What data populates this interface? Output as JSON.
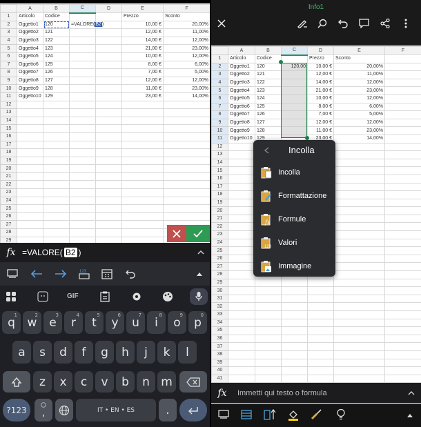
{
  "left": {
    "columns": [
      "A",
      "B",
      "C",
      "D",
      "E",
      "F"
    ],
    "headers": {
      "A": "Articolo",
      "B": "Codice",
      "E": "Prezzo",
      "F": "Sconto"
    },
    "rows": [
      {
        "a": "Oggetto1",
        "b": "120",
        "c": "=VALORE(",
        "e": "10,00 €",
        "f": "20,00%"
      },
      {
        "a": "Oggetto2",
        "b": "121",
        "e": "12,00 €",
        "f": "11,00%"
      },
      {
        "a": "Oggetto3",
        "b": "122",
        "e": "14,00 €",
        "f": "12,00%"
      },
      {
        "a": "Oggetto4",
        "b": "123",
        "e": "21,00 €",
        "f": "23,00%"
      },
      {
        "a": "Oggetto5",
        "b": "124",
        "e": "10,00 €",
        "f": "12,00%"
      },
      {
        "a": "Oggetto6",
        "b": "125",
        "e": "8,00 €",
        "f": "6,00%"
      },
      {
        "a": "Oggetto7",
        "b": "126",
        "e": "7,00 €",
        "f": "5,00%"
      },
      {
        "a": "Oggetto8",
        "b": "127",
        "e": "12,00 €",
        "f": "12,00%"
      },
      {
        "a": "Oggetto9",
        "b": "128",
        "e": "11,00 €",
        "f": "23,00%"
      },
      {
        "a": "Oggetto10",
        "b": "129",
        "e": "23,00 €",
        "f": "14,00%"
      }
    ],
    "row_count": 30,
    "cell_formula_prefix": "=VALORE(",
    "cell_formula_ref": "B2",
    "cell_formula_suffix": ")",
    "fx_label": "fx",
    "formula_prefix": "=VALORE(",
    "formula_ref": "B2",
    "formula_suffix": ")",
    "toolbar_icons": [
      "keyboard-icon",
      "arrow-left-icon",
      "arrow-right-icon",
      "number-keyboard-icon",
      "calendar-icon",
      "undo-icon",
      "expand-up-icon"
    ],
    "kb_top_icons": [
      "grid-icon",
      "sticker-icon",
      "gif-icon",
      "clipboard-icon",
      "settings-icon",
      "palette-icon",
      "mic-icon"
    ],
    "gif_label": "GIF",
    "keyboard": {
      "row1": [
        {
          "k": "q",
          "h": "1"
        },
        {
          "k": "w",
          "h": "2"
        },
        {
          "k": "e",
          "h": "3"
        },
        {
          "k": "r",
          "h": "4"
        },
        {
          "k": "t",
          "h": "5"
        },
        {
          "k": "y",
          "h": "6"
        },
        {
          "k": "u",
          "h": "7"
        },
        {
          "k": "i",
          "h": "8"
        },
        {
          "k": "o",
          "h": "9"
        },
        {
          "k": "p",
          "h": "0"
        }
      ],
      "row2": [
        "a",
        "s",
        "d",
        "f",
        "g",
        "h",
        "j",
        "k",
        "l"
      ],
      "row3": [
        "z",
        "x",
        "c",
        "v",
        "b",
        "n",
        "m"
      ],
      "sym_label": "?123",
      "comma_label": ",",
      "space_label": "IT • EN • ES",
      "period_label": "."
    }
  },
  "right": {
    "title": "Info1",
    "columns": [
      "A",
      "B",
      "C",
      "D",
      "E",
      "F"
    ],
    "headers": {
      "A": "Articolo",
      "B": "Codice",
      "D": "Prezzo",
      "E": "Sconto"
    },
    "c2_value": "120,00",
    "rows": [
      {
        "a": "Oggetto1",
        "b": "120",
        "d": "10,00 €",
        "e": "20,00%"
      },
      {
        "a": "Oggetto2",
        "b": "121",
        "d": "12,00 €",
        "e": "11,00%"
      },
      {
        "a": "Oggetto3",
        "b": "122",
        "d": "14,00 €",
        "e": "12,00%"
      },
      {
        "a": "Oggetto4",
        "b": "123",
        "d": "21,00 €",
        "e": "23,00%"
      },
      {
        "a": "Oggetto5",
        "b": "124",
        "d": "10,00 €",
        "e": "12,00%"
      },
      {
        "a": "Oggetto6",
        "b": "125",
        "d": "8,00 €",
        "e": "6,00%"
      },
      {
        "a": "Oggetto7",
        "b": "126",
        "d": "7,00 €",
        "e": "5,00%"
      },
      {
        "a": "Oggetto8",
        "b": "127",
        "d": "12,00 €",
        "e": "12,00%"
      },
      {
        "a": "Oggetto9",
        "b": "128",
        "d": "11,00 €",
        "e": "23,00%"
      },
      {
        "a": "Oggetto10",
        "b": "129",
        "d": "23,00 €",
        "e": "14,00%"
      }
    ],
    "row_count": 41,
    "menu": {
      "title": "Incolla",
      "items": [
        {
          "label": "Incolla",
          "icon": "paste-icon"
        },
        {
          "label": "Formattazione",
          "icon": "paste-formatting-icon"
        },
        {
          "label": "Formule",
          "icon": "paste-formulas-icon"
        },
        {
          "label": "Valori",
          "icon": "paste-values-icon"
        },
        {
          "label": "Immagine",
          "icon": "paste-image-icon"
        }
      ]
    },
    "fx_label": "fx",
    "formula_placeholder": "Immetti qui testo o formula",
    "bottom_icons": [
      "keyboard-icon",
      "card-icon",
      "sort-icon",
      "fill-color-icon",
      "brush-icon",
      "lightbulb-icon",
      "collapse-icon"
    ],
    "accent": "#1e8449",
    "highlight_color": "#ffd200"
  }
}
